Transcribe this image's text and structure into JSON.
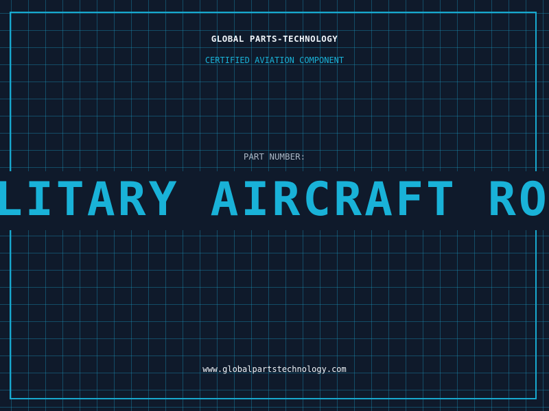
{
  "brand": {
    "name": "GLOBAL PARTS-TECHNOLOGY",
    "tagline": "CERTIFIED AVIATION COMPONENT"
  },
  "part": {
    "label": "PART NUMBER:",
    "value": "MILITARY AIRCRAFT ROUND"
  },
  "footer": {
    "website": "www.globalpartstechnology.com"
  },
  "colors": {
    "background": "#0f1a2b",
    "accent": "#19b2d8",
    "grid": "#1c96be",
    "text": "#eef3f8",
    "muted": "#aab6c4"
  }
}
